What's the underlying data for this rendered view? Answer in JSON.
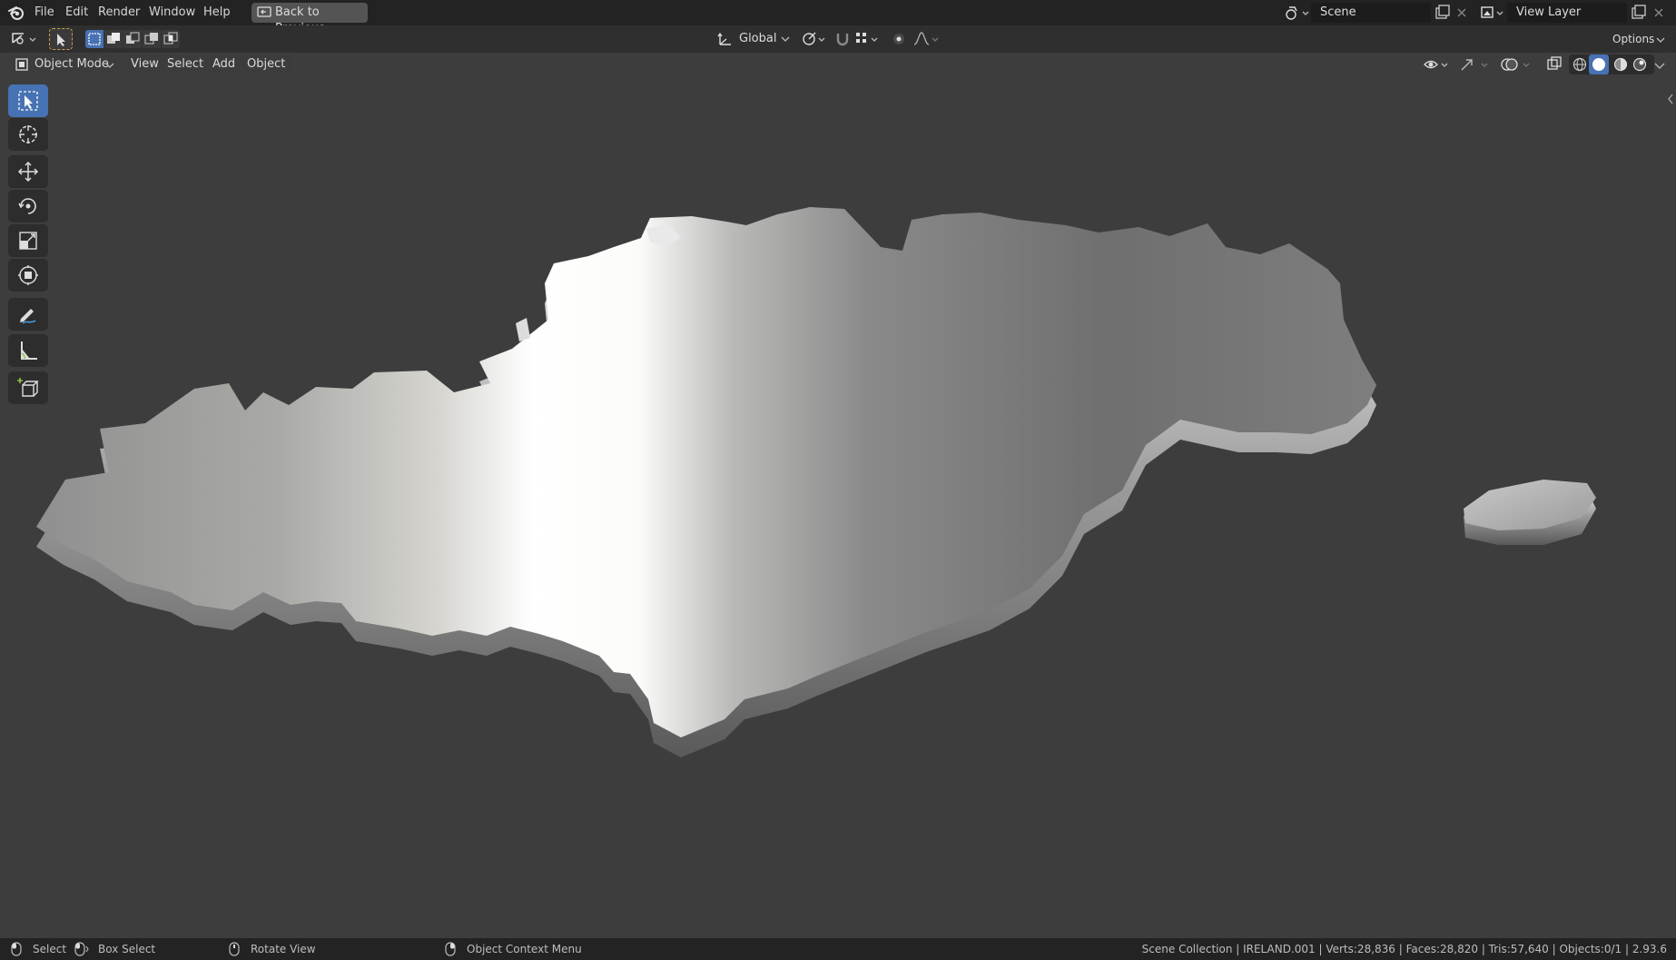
{
  "topbar": {
    "menus": [
      "File",
      "Edit",
      "Render",
      "Window",
      "Help"
    ],
    "back_button": "Back to Previous",
    "scene_name": "Scene",
    "view_layer_name": "View Layer"
  },
  "toolheader": {
    "orientation": "Global",
    "options_label": "Options"
  },
  "viewport_header": {
    "mode": "Object Mode",
    "menus": [
      "View",
      "Select",
      "Add",
      "Object"
    ]
  },
  "statusbar": {
    "hints": [
      "Select",
      "Box Select",
      "Rotate View",
      "Object Context Menu"
    ],
    "stats": "Scene Collection | IRELAND.001 | Verts:28,836 | Faces:28,820 | Tris:57,640 | Objects:0/1 | 2.93.6"
  },
  "colors": {
    "accent": "#4772b3",
    "viewport_bg": "#3d3d3d",
    "header_bg": "#232323"
  }
}
